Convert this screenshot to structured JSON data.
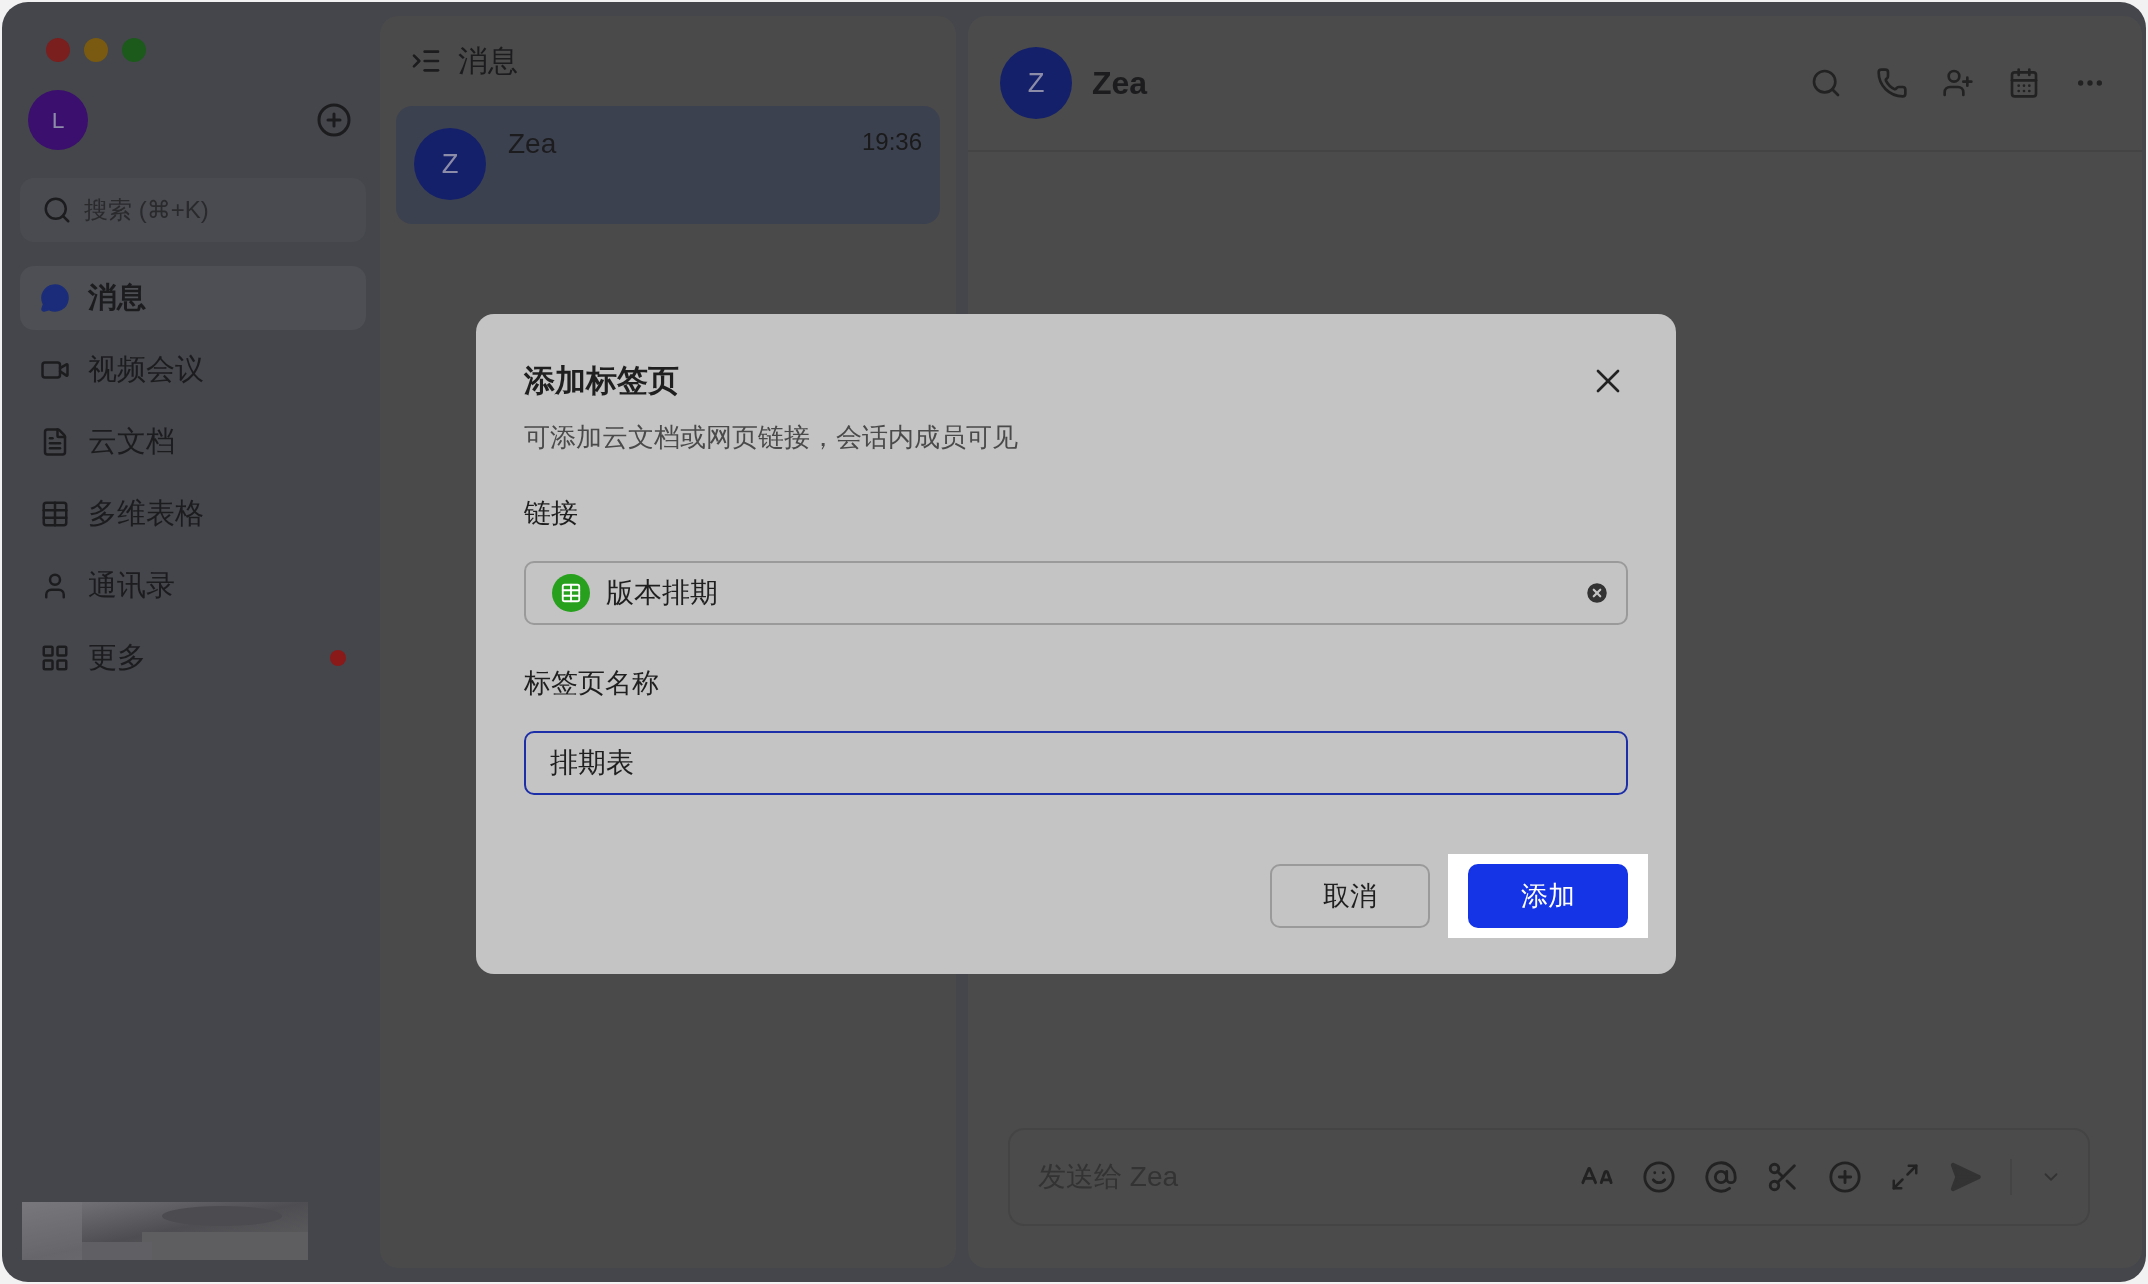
{
  "sidebar": {
    "avatar": "L",
    "search": {
      "placeholder": "搜索 (⌘+K)"
    },
    "items": [
      {
        "label": "消息",
        "selected": true,
        "dot": false
      },
      {
        "label": "视频会议",
        "selected": false,
        "dot": false
      },
      {
        "label": "云文档",
        "selected": false,
        "dot": false
      },
      {
        "label": "多维表格",
        "selected": false,
        "dot": false
      },
      {
        "label": "通讯录",
        "selected": false,
        "dot": false
      },
      {
        "label": "更多",
        "selected": false,
        "dot": true
      }
    ]
  },
  "chat_list": {
    "title": "消息",
    "chats": [
      {
        "avatar": "Z",
        "name": "Zea",
        "time": "19:36",
        "selected": true
      }
    ]
  },
  "conversation": {
    "avatar": "Z",
    "name": "Zea",
    "composer": {
      "placeholder": "发送给 Zea"
    }
  },
  "dialog": {
    "title": "添加标签页",
    "subtitle": "可添加云文档或网页链接，会话内成员可见",
    "link_label": "链接",
    "link_value": "版本排期",
    "name_label": "标签页名称",
    "name_value": "排期表",
    "buttons": [
      {
        "label": "取消",
        "kind": "secondary",
        "highlighted": false
      },
      {
        "label": "添加",
        "kind": "primary",
        "highlighted": true
      }
    ]
  }
}
